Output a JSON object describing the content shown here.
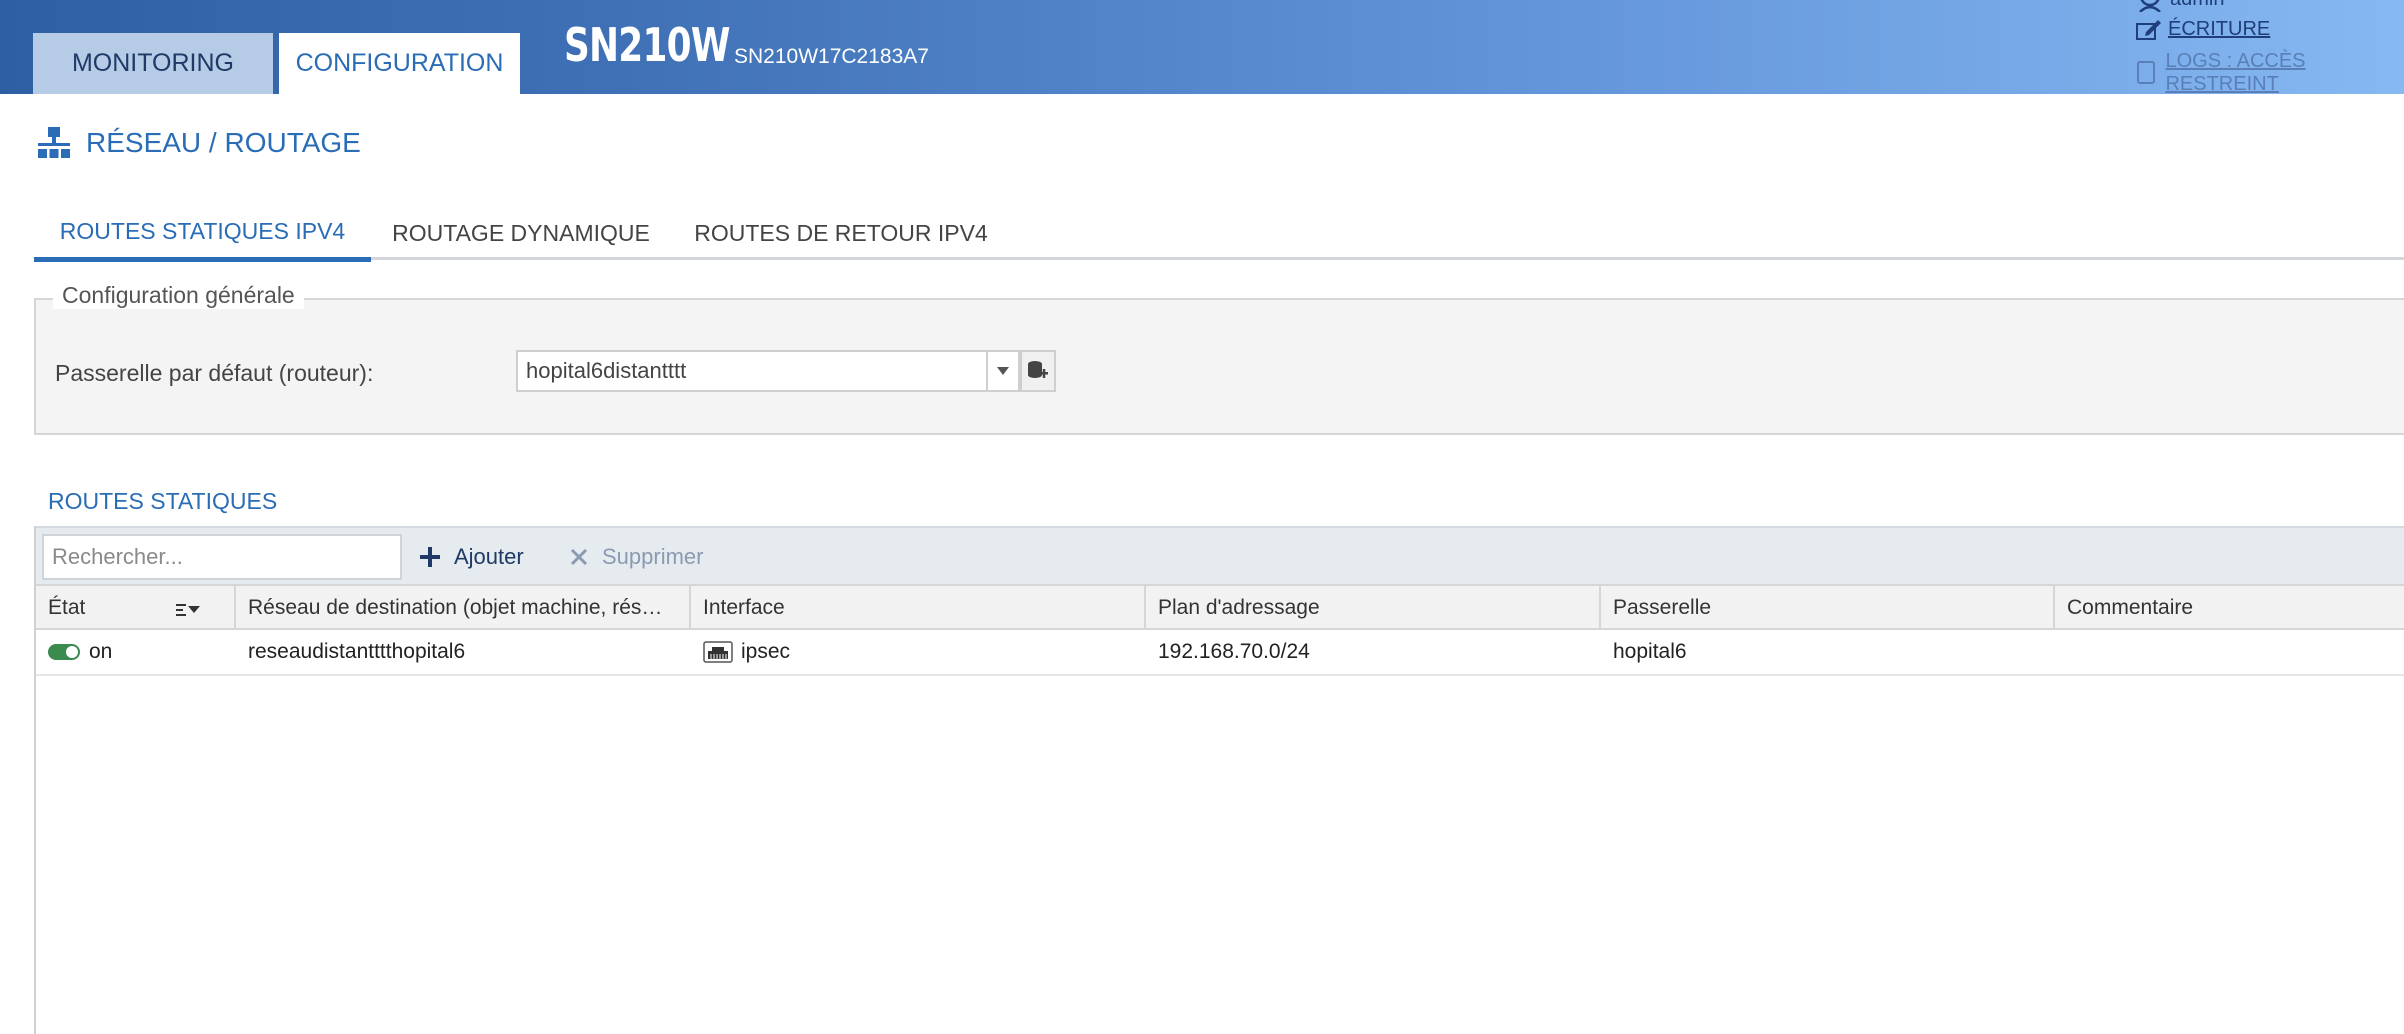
{
  "header": {
    "tabs": [
      {
        "label": "MONITORING",
        "active": false
      },
      {
        "label": "CONFIGURATION",
        "active": true
      }
    ],
    "product": "SN210W",
    "serial": "SN210W17C2183A7",
    "user": {
      "name": "admin",
      "write_link": "ÉCRITURE",
      "logs_link": "LOGS : ACCÈS RESTREINT"
    }
  },
  "page": {
    "title": "RÉSEAU / ROUTAGE",
    "title_icon": "network-icon"
  },
  "subtabs": [
    {
      "label": "ROUTES STATIQUES IPV4",
      "active": true
    },
    {
      "label": "ROUTAGE DYNAMIQUE",
      "active": false
    },
    {
      "label": "ROUTES DE RETOUR IPV4",
      "active": false
    }
  ],
  "general_config": {
    "legend": "Configuration générale",
    "gateway_label": "Passerelle par défaut (routeur):",
    "gateway_value": "hopital6distantttt"
  },
  "static_routes": {
    "title": "ROUTES STATIQUES",
    "search_placeholder": "Rechercher...",
    "add_label": "Ajouter",
    "delete_label": "Supprimer",
    "columns": [
      "État",
      "Réseau de destination (objet machine, rés…",
      "Interface",
      "Plan d'adressage",
      "Passerelle",
      "Commentaire"
    ],
    "rows": [
      {
        "state": "on",
        "enabled": true,
        "destination": "reseaudistantttthopital6",
        "interface": "ipsec",
        "addressing": "192.168.70.0/24",
        "gateway": "hopital6",
        "comment": ""
      }
    ]
  },
  "colors": {
    "accent": "#2a6cb5",
    "header_start": "#2f5fa3",
    "header_end": "#86b8f2",
    "toggle_on": "#3b8a4e"
  }
}
